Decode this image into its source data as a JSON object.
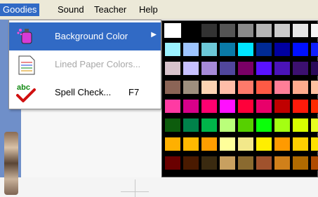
{
  "menubar": {
    "items": [
      "Goodies",
      "Sound",
      "Teacher",
      "Help"
    ],
    "active_index": 0
  },
  "menu": {
    "items": [
      {
        "label": "Background Color",
        "shortcut": "",
        "icon": "paint-spray-icon",
        "selected": true,
        "disabled": false,
        "submenu": true
      },
      {
        "label": "Lined Paper Colors...",
        "shortcut": "",
        "icon": "lined-paper-icon",
        "selected": false,
        "disabled": true,
        "submenu": false
      },
      {
        "label": "Spell Check...",
        "shortcut": "F7",
        "icon": "spell-check-icon",
        "selected": false,
        "disabled": false,
        "submenu": false
      }
    ],
    "submenu_arrow": "▶"
  },
  "palette": {
    "rows": [
      [
        "#ffffff",
        "#000000",
        "#323232",
        "#555555",
        "#8a8a8a",
        "#b5b5b5",
        "#cccccc",
        "#e6e6e6",
        "#f5f5f5"
      ],
      [
        "#9bf2ff",
        "#9ec5ff",
        "#6cc8d8",
        "#0a7aa7",
        "#00e5ff",
        "#002a94",
        "#0000a0",
        "#0010ff",
        "#1020ff"
      ],
      [
        "#d8c3cc",
        "#c7c0ff",
        "#a68ad9",
        "#50469c",
        "#7a0066",
        "#5a12ff",
        "#4a13b8",
        "#3c1070",
        "#2a0a5a"
      ],
      [
        "#8b6456",
        "#9e8f7e",
        "#fcd3b3",
        "#ffbda8",
        "#ff7a6a",
        "#ff5a45",
        "#ff7e98",
        "#ffab8e",
        "#ffc0a0"
      ],
      [
        "#ff3aa3",
        "#d8008a",
        "#ff0070",
        "#ff10ff",
        "#ff003a",
        "#e8006a",
        "#c00000",
        "#ff1a0a",
        "#ff2a00"
      ],
      [
        "#0d5c0d",
        "#00824a",
        "#00b54a",
        "#baff7a",
        "#56d000",
        "#0aff0a",
        "#a4ff12",
        "#d8ff00",
        "#e8ff20"
      ],
      [
        "#ffb000",
        "#ffb900",
        "#ff9e00",
        "#ffff9a",
        "#f2e88a",
        "#ffee00",
        "#ff9a00",
        "#ffd000",
        "#ffe000"
      ],
      [
        "#6a0000",
        "#4a1a00",
        "#3a2a10",
        "#c8a060",
        "#8a6a30",
        "#a0522d",
        "#d0801a",
        "#b06a00",
        "#b04a00"
      ]
    ],
    "selected": [
      0,
      0
    ]
  }
}
